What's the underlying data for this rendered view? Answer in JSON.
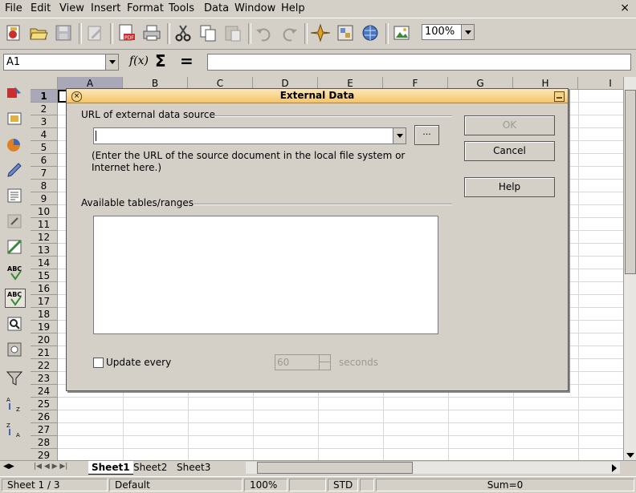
{
  "menu": [
    {
      "u": "F",
      "rest": "ile"
    },
    {
      "u": "E",
      "rest": "dit"
    },
    {
      "u": "V",
      "rest": "iew"
    },
    {
      "u": "I",
      "rest": "nsert"
    },
    {
      "u": "",
      "rest": "Format",
      "um": "F"
    },
    {
      "u": "T",
      "rest": "ools"
    },
    {
      "u": "D",
      "rest": "ata"
    },
    {
      "u": "W",
      "rest": "indow"
    },
    {
      "u": "H",
      "rest": "elp"
    }
  ],
  "menu_labels": [
    "File",
    "Edit",
    "View",
    "Insert",
    "Format",
    "Tools",
    "Data",
    "Window",
    "Help"
  ],
  "close_doc": "×",
  "toolbar": {
    "zoom": "100%"
  },
  "formula": {
    "cell_ref": "A1",
    "value": "",
    "fx": "f(x)",
    "sigma": "Σ",
    "equals": "="
  },
  "columns": [
    "A",
    "B",
    "C",
    "D",
    "E",
    "F",
    "G",
    "H",
    "I"
  ],
  "rows": [
    "1",
    "2",
    "3",
    "4",
    "5",
    "6",
    "7",
    "8",
    "9",
    "10",
    "11",
    "12",
    "13",
    "14",
    "15",
    "16",
    "17",
    "18",
    "19",
    "20",
    "21",
    "22",
    "23",
    "24",
    "25",
    "26",
    "27",
    "28",
    "29"
  ],
  "sheets": [
    "Sheet1",
    "Sheet2",
    "Sheet3"
  ],
  "status": {
    "sheet": "Sheet 1 / 3",
    "style": "Default",
    "zoom": "100%",
    "mode": "STD",
    "sum": "Sum=0"
  },
  "dialog": {
    "title": "External Data",
    "url_label": "URL of external data source",
    "url_value": "",
    "browse": "...",
    "hint": "(Enter the URL of the source document in the local file system or Internet here.)",
    "tables_label": "Available tables/ranges",
    "update_label": "Update every",
    "seconds_value": "60",
    "seconds_label": "seconds",
    "ok": "OK",
    "cancel": "Cancel",
    "help": "Help"
  }
}
